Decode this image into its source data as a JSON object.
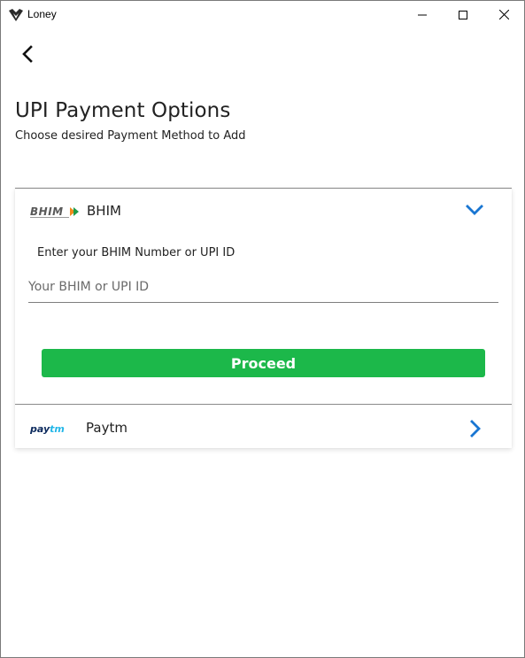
{
  "window": {
    "title": "Loney",
    "controls": [
      "minimize-icon",
      "maximize-icon",
      "close-icon"
    ]
  },
  "nav": {
    "back_icon": "chevron-left-icon"
  },
  "page": {
    "title": "UPI Payment Options",
    "subtitle": "Choose desired Payment Method to Add"
  },
  "options": [
    {
      "name": "BHIM",
      "logo": "bhim-logo",
      "logo_text": "BHIM",
      "expanded": true,
      "indicator_icon": "chevron-down-icon",
      "field_label": "Enter your BHIM Number or UPI ID",
      "field_value": "",
      "field_placeholder": "Your BHIM or UPI ID",
      "button_label": "Proceed"
    },
    {
      "name": "Paytm",
      "logo": "paytm-logo",
      "logo_text": "paytm",
      "expanded": false,
      "indicator_icon": "chevron-right-icon"
    }
  ],
  "colors": {
    "accent_blue": "#1976d2",
    "proceed_green": "#1cb84a",
    "paytm_dark": "#0d2b5e",
    "paytm_light": "#24b7e8"
  }
}
